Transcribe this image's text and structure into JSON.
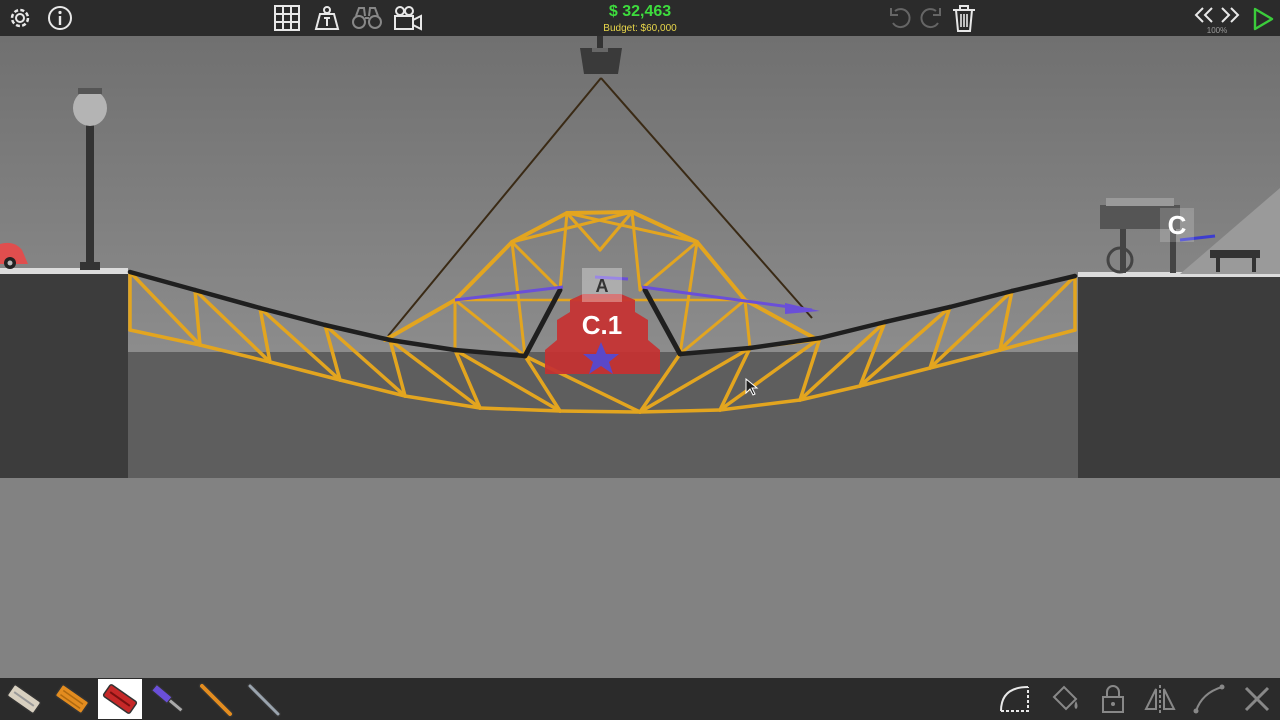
{
  "hud": {
    "money": "$ 32,463",
    "budget": "Budget: $60,000",
    "sim_speed": "100%"
  },
  "labels": {
    "checkpoint_center": "C.1",
    "checkpoint_right": "C",
    "anchor": "A"
  },
  "toolbar_top": {
    "left_icons": [
      "settings-icon",
      "info-icon"
    ],
    "tools": [
      "grid-icon",
      "weight-icon",
      "binoculars-icon",
      "camera-icon"
    ],
    "history": [
      "undo-icon",
      "redo-icon",
      "trash-icon"
    ],
    "playback": [
      "rewind-icon",
      "fast-forward-icon",
      "play-icon"
    ]
  },
  "materials": [
    "road",
    "wood",
    "reinforced-road",
    "hydraulic",
    "wood-beam",
    "steel"
  ],
  "toolbar_bottom_right": [
    "select-curve-icon",
    "paint-bucket-icon",
    "lock-icon",
    "mirror-icon",
    "split-joint-icon",
    "delete-x-icon"
  ],
  "colors": {
    "bar": "#2b2b2b",
    "money": "#3ddc3d",
    "budget": "#e8d64a",
    "wood": "#e3a51f",
    "road": "#1f1f1f",
    "hydraulic": "#6a4fd8",
    "checkpoint": "#c63232",
    "play": "#3bcc3b"
  }
}
